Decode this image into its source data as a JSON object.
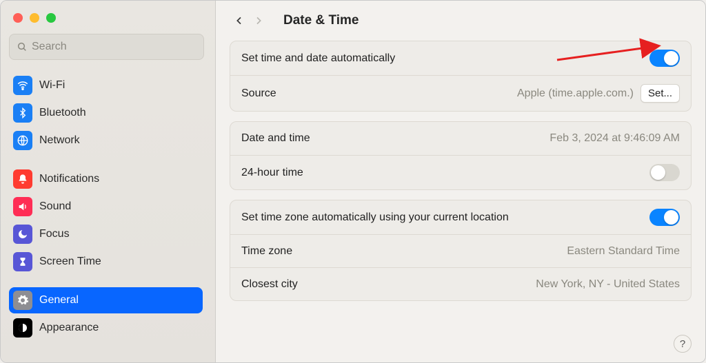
{
  "window": {
    "search_placeholder": "Search"
  },
  "sidebar": {
    "groups": [
      {
        "items": [
          {
            "id": "wifi",
            "label": "Wi-Fi"
          },
          {
            "id": "bluetooth",
            "label": "Bluetooth"
          },
          {
            "id": "network",
            "label": "Network"
          }
        ]
      },
      {
        "items": [
          {
            "id": "notifications",
            "label": "Notifications"
          },
          {
            "id": "sound",
            "label": "Sound"
          },
          {
            "id": "focus",
            "label": "Focus"
          },
          {
            "id": "screentime",
            "label": "Screen Time"
          }
        ]
      },
      {
        "items": [
          {
            "id": "general",
            "label": "General",
            "selected": true
          },
          {
            "id": "appearance",
            "label": "Appearance"
          }
        ]
      }
    ]
  },
  "header": {
    "title": "Date & Time"
  },
  "panel1": {
    "auto_time_label": "Set time and date automatically",
    "auto_time_on": true,
    "source_label": "Source",
    "source_value": "Apple (time.apple.com.)",
    "set_button": "Set..."
  },
  "panel2": {
    "datetime_label": "Date and time",
    "datetime_value": "Feb 3, 2024 at 9:46:09 AM",
    "h24_label": "24-hour time",
    "h24_on": false
  },
  "panel3": {
    "auto_tz_label": "Set time zone automatically using your current location",
    "auto_tz_on": true,
    "tz_label": "Time zone",
    "tz_value": "Eastern Standard Time",
    "city_label": "Closest city",
    "city_value": "New York, NY - United States"
  },
  "help": "?"
}
